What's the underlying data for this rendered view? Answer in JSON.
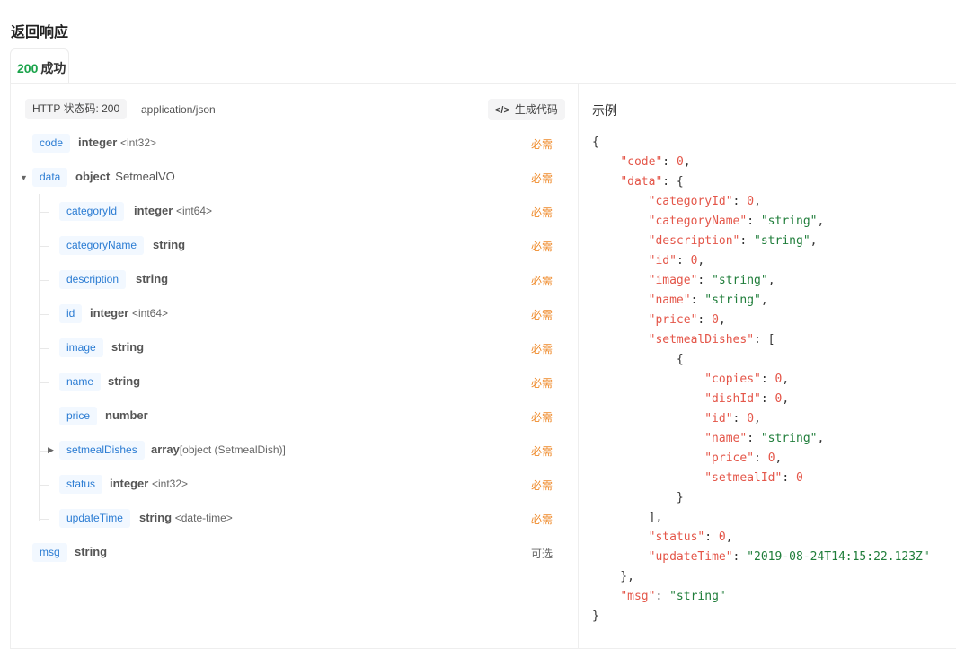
{
  "response": {
    "title": "返回响应",
    "tab": {
      "code": "200",
      "label": "成功"
    },
    "status_pill": "HTTP 状态码: 200",
    "content_type": "application/json",
    "generate_code_label": "生成代码"
  },
  "fields": {
    "code": {
      "name": "code",
      "type": "integer",
      "format": "<int32>",
      "req": "必需"
    },
    "data": {
      "name": "data",
      "type": "object",
      "type_name": "SetmealVO",
      "req": "必需"
    },
    "categoryId": {
      "name": "categoryId",
      "type": "integer",
      "format": "<int64>",
      "req": "必需"
    },
    "categoryName": {
      "name": "categoryName",
      "type": "string",
      "req": "必需"
    },
    "description": {
      "name": "description",
      "type": "string",
      "req": "必需"
    },
    "id": {
      "name": "id",
      "type": "integer",
      "format": "<int64>",
      "req": "必需"
    },
    "image": {
      "name": "image",
      "type": "string",
      "req": "必需"
    },
    "name": {
      "name": "name",
      "type": "string",
      "req": "必需"
    },
    "price": {
      "name": "price",
      "type": "number",
      "req": "必需"
    },
    "setmealDishes": {
      "name": "setmealDishes",
      "type": "array",
      "format": "[object (SetmealDish)]",
      "req": "必需"
    },
    "status": {
      "name": "status",
      "type": "integer",
      "format": "<int32>",
      "req": "必需"
    },
    "updateTime": {
      "name": "updateTime",
      "type": "string",
      "format": "<date-time>",
      "req": "必需"
    },
    "msg": {
      "name": "msg",
      "type": "string",
      "req": "可选"
    }
  },
  "example": {
    "title": "示例",
    "json": [
      "{",
      "    \"code\": 0,",
      "    \"data\": {",
      "        \"categoryId\": 0,",
      "        \"categoryName\": \"string\",",
      "        \"description\": \"string\",",
      "        \"id\": 0,",
      "        \"image\": \"string\",",
      "        \"name\": \"string\",",
      "        \"price\": 0,",
      "        \"setmealDishes\": [",
      "            {",
      "                \"copies\": 0,",
      "                \"dishId\": 0,",
      "                \"id\": 0,",
      "                \"name\": \"string\",",
      "                \"price\": 0,",
      "                \"setmealId\": 0",
      "            }",
      "        ],",
      "        \"status\": 0,",
      "        \"updateTime\": \"2019-08-24T14:15:22.123Z\"",
      "    },",
      "    \"msg\": \"string\"",
      "}"
    ]
  },
  "colors": {
    "success": "#1aa34a",
    "field_name": "#2b7cd3",
    "required": "#ef8a2a",
    "json_key": "#e45649",
    "json_string": "#1f7d3a"
  },
  "icons": {
    "generate_code": "code-icon",
    "expand_data": "triangle-down-icon",
    "expand_setmealDishes": "triangle-right-icon"
  }
}
